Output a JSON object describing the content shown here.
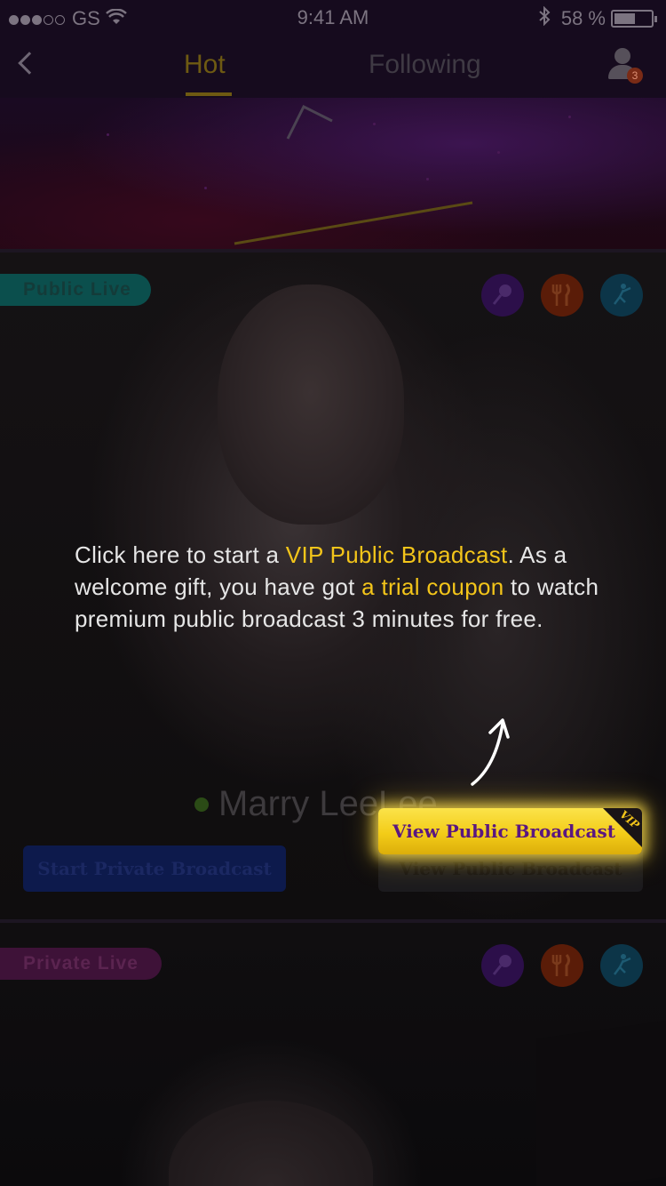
{
  "status_bar": {
    "carrier": "GS",
    "time": "9:41 AM",
    "battery": "58 %",
    "battery_level": 0.58
  },
  "nav": {
    "tabs": [
      {
        "label": "Hot",
        "active": true
      },
      {
        "label": "Following",
        "active": false
      }
    ],
    "notification_count": "3"
  },
  "cards": [
    {
      "tag": "Public Live",
      "streamer_name": "Marry LeeLee",
      "icons": [
        "mic-icon",
        "food-icon",
        "dance-icon"
      ],
      "private_button": "Start Private Broadcast",
      "public_button": "View Public Broadcast"
    },
    {
      "tag": "Private Live",
      "icons": [
        "mic-icon",
        "food-icon",
        "dance-icon"
      ]
    }
  ],
  "hint": {
    "part1": "Click here to start a ",
    "highlight1": "VIP Public Broadcast",
    "part2": ". As a welcome gift, you have got ",
    "highlight2": "a trial coupon",
    "part3": " to watch premium public broadcast 3 minutes for free."
  },
  "vip_button": {
    "label": "View Public Broadcast",
    "badge": "VIP"
  },
  "colors": {
    "accent_gold": "#f3c51a",
    "vip_text_purple": "#5a1780",
    "overlay": "rgba(0,0,0,0.7)"
  }
}
